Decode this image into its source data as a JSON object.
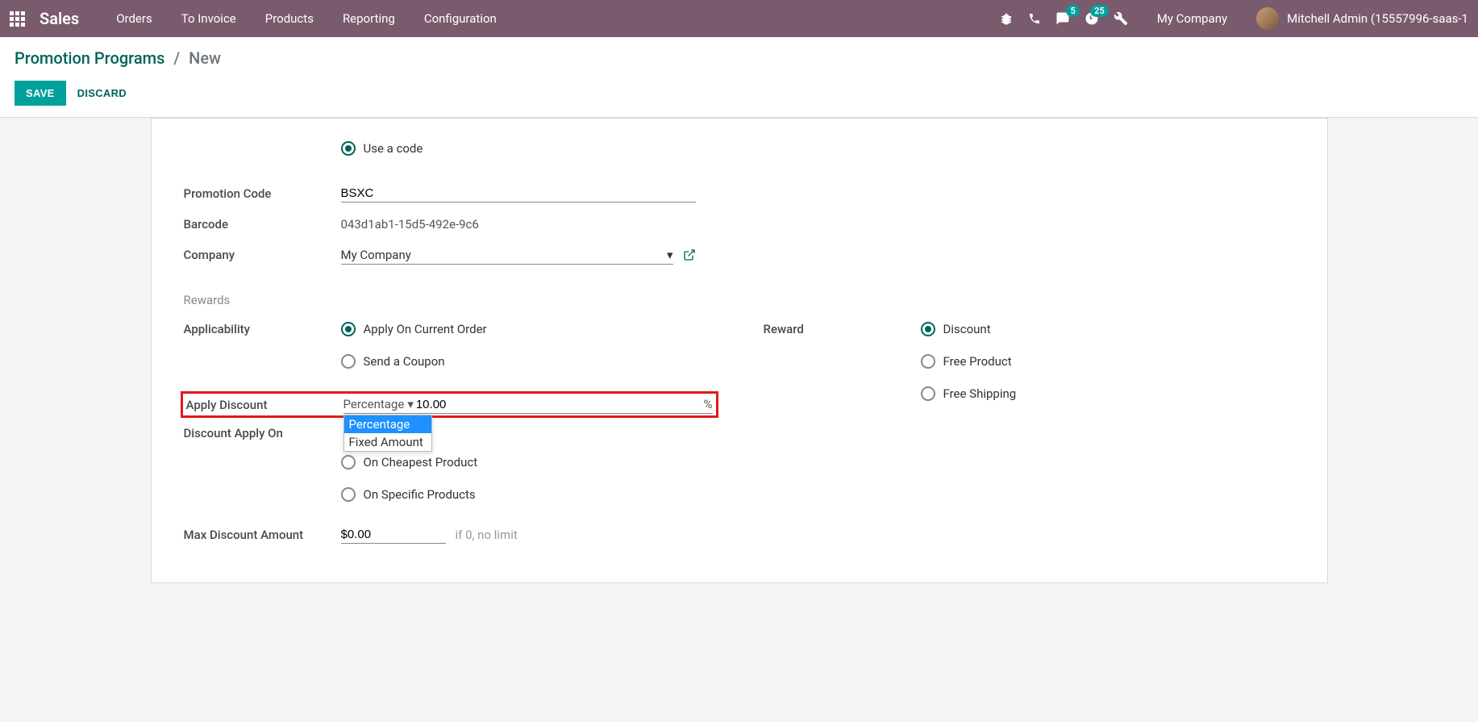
{
  "nav": {
    "brand": "Sales",
    "items": [
      "Orders",
      "To Invoice",
      "Products",
      "Reporting",
      "Configuration"
    ],
    "msg_badge": "5",
    "activity_badge": "25",
    "company": "My Company",
    "user": "Mitchell Admin (15557996-saas-1"
  },
  "breadcrumb": {
    "root": "Promotion Programs",
    "current": "New"
  },
  "buttons": {
    "save": "SAVE",
    "discard": "DISCARD"
  },
  "form": {
    "use_a_code": "Use a code",
    "promo_code_label": "Promotion Code",
    "promo_code_value": "BSXC",
    "barcode_label": "Barcode",
    "barcode_value": "043d1ab1-15d5-492e-9c6",
    "company_label": "Company",
    "company_value": "My Company",
    "rewards_section": "Rewards",
    "applicability_label": "Applicability",
    "applicability_options": [
      "Apply On Current Order",
      "Send a Coupon"
    ],
    "reward_label": "Reward",
    "reward_options": [
      "Discount",
      "Free Product",
      "Free Shipping"
    ],
    "apply_discount_label": "Apply Discount",
    "apply_discount_type": "Percentage",
    "apply_discount_value": "10.00",
    "apply_discount_unit": "%",
    "discount_apply_on_label": "Discount Apply On",
    "discount_apply_on_options": [
      "On Cheapest Product",
      "On Specific Products"
    ],
    "max_discount_label": "Max Discount Amount",
    "max_discount_value": "$0.00",
    "max_discount_hint": "if 0, no limit",
    "dropdown_options": [
      "Percentage",
      "Fixed Amount"
    ]
  }
}
